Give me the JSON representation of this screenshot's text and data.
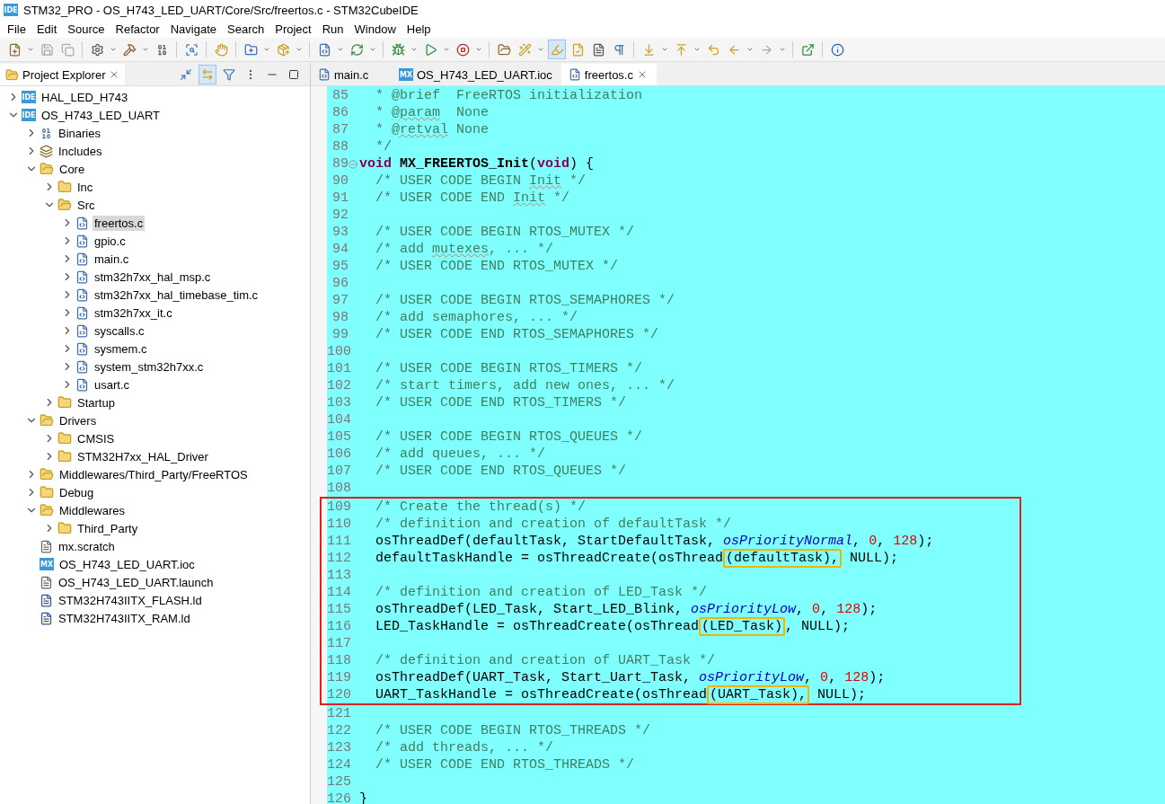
{
  "window": {
    "icon_text": "IDE",
    "title": "STM32_PRO - OS_H743_LED_UART/Core/Src/freertos.c - STM32CubeIDE"
  },
  "menu": [
    "File",
    "Edit",
    "Source",
    "Refactor",
    "Navigate",
    "Search",
    "Project",
    "Run",
    "Window",
    "Help"
  ],
  "toolbar": {
    "highlight_toggle_on": true
  },
  "explorer": {
    "title": "Project Explorer",
    "link_with_editor": true,
    "tree": [
      {
        "label": "HAL_LED_H743",
        "kind": "project",
        "badge": "IDE",
        "expanded": false,
        "selected": false
      },
      {
        "label": "OS_H743_LED_UART",
        "kind": "project",
        "badge": "IDE",
        "expanded": true,
        "selected": false,
        "children": [
          {
            "label": "Binaries",
            "kind": "binaries",
            "expanded": false,
            "selected": false
          },
          {
            "label": "Includes",
            "kind": "includes",
            "expanded": false,
            "selected": false
          },
          {
            "label": "Core",
            "kind": "source-folder",
            "expanded": true,
            "selected": false,
            "children": [
              {
                "label": "Inc",
                "kind": "folder",
                "expanded": false,
                "selected": false
              },
              {
                "label": "Src",
                "kind": "folder",
                "expanded": true,
                "selected": false,
                "children": [
                  {
                    "label": "freertos.c",
                    "kind": "c-file",
                    "expanded": false,
                    "selected": true
                  },
                  {
                    "label": "gpio.c",
                    "kind": "c-file",
                    "expanded": false,
                    "selected": false
                  },
                  {
                    "label": "main.c",
                    "kind": "c-file",
                    "expanded": false,
                    "selected": false
                  },
                  {
                    "label": "stm32h7xx_hal_msp.c",
                    "kind": "c-file",
                    "expanded": false,
                    "selected": false
                  },
                  {
                    "label": "stm32h7xx_hal_timebase_tim.c",
                    "kind": "c-file",
                    "expanded": false,
                    "selected": false
                  },
                  {
                    "label": "stm32h7xx_it.c",
                    "kind": "c-file",
                    "expanded": false,
                    "selected": false
                  },
                  {
                    "label": "syscalls.c",
                    "kind": "c-file",
                    "expanded": false,
                    "selected": false
                  },
                  {
                    "label": "sysmem.c",
                    "kind": "c-file",
                    "expanded": false,
                    "selected": false
                  },
                  {
                    "label": "system_stm32h7xx.c",
                    "kind": "c-file",
                    "expanded": false,
                    "selected": false
                  },
                  {
                    "label": "usart.c",
                    "kind": "c-file",
                    "expanded": false,
                    "selected": false
                  }
                ]
              },
              {
                "label": "Startup",
                "kind": "folder",
                "expanded": false,
                "selected": false
              }
            ]
          },
          {
            "label": "Drivers",
            "kind": "source-folder",
            "expanded": true,
            "selected": false,
            "children": [
              {
                "label": "CMSIS",
                "kind": "folder",
                "expanded": false,
                "selected": false
              },
              {
                "label": "STM32H7xx_HAL_Driver",
                "kind": "folder",
                "expanded": false,
                "selected": false
              }
            ]
          },
          {
            "label": "Middlewares/Third_Party/FreeRTOS",
            "kind": "source-folder",
            "expanded": false,
            "selected": false
          },
          {
            "label": "Debug",
            "kind": "folder",
            "expanded": false,
            "selected": false
          },
          {
            "label": "Middlewares",
            "kind": "folder",
            "expanded": true,
            "selected": false,
            "children": [
              {
                "label": "Third_Party",
                "kind": "folder",
                "expanded": false,
                "selected": false
              }
            ]
          },
          {
            "label": "mx.scratch",
            "kind": "text-file",
            "selected": false
          },
          {
            "label": "OS_H743_LED_UART.ioc",
            "kind": "mx-file",
            "badge": "MX",
            "selected": false
          },
          {
            "label": "OS_H743_LED_UART.launch",
            "kind": "text-file",
            "selected": false
          },
          {
            "label": "STM32H743IITX_FLASH.ld",
            "kind": "ld-file",
            "selected": false
          },
          {
            "label": "STM32H743IITX_RAM.ld",
            "kind": "ld-file",
            "selected": false
          }
        ]
      }
    ]
  },
  "editor": {
    "tabs": [
      {
        "label": "main.c",
        "kind": "c-file",
        "selected": false
      },
      {
        "label": "OS_H743_LED_UART.ioc",
        "kind": "mx-file",
        "badge": "MX",
        "selected": false
      },
      {
        "label": "freertos.c",
        "kind": "c-file",
        "selected": true
      }
    ],
    "blocks": [
      {
        "highlighted": false,
        "lines": [
          {
            "number": "85",
            "tokens": [
              {
                "kind": "comment",
                "text": "  * @brief  FreeRTOS initialization"
              }
            ]
          },
          {
            "number": "86",
            "tokens": [
              {
                "kind": "comment",
                "text": "  * "
              },
              {
                "kind": "comment",
                "text": "@param",
                "misspelled": true
              },
              {
                "kind": "comment",
                "text": "  None"
              }
            ]
          },
          {
            "number": "87",
            "tokens": [
              {
                "kind": "comment",
                "text": "  * "
              },
              {
                "kind": "comment",
                "text": "@retval",
                "misspelled": true
              },
              {
                "kind": "comment",
                "text": " None"
              }
            ]
          },
          {
            "number": "88",
            "tokens": [
              {
                "kind": "comment",
                "text": "  */"
              }
            ]
          },
          {
            "number": "89",
            "fold": true,
            "tokens": [
              {
                "kind": "keyword",
                "text": "void"
              },
              {
                "kind": "function",
                "text": " MX_FREERTOS_Init"
              },
              {
                "kind": "plain",
                "text": "("
              },
              {
                "kind": "keyword",
                "text": "void"
              },
              {
                "kind": "plain",
                "text": ") {"
              }
            ]
          },
          {
            "number": "90",
            "tokens": [
              {
                "kind": "comment",
                "text": "  /* USER CODE BEGIN "
              },
              {
                "kind": "comment",
                "text": "Init",
                "misspelled": true
              },
              {
                "kind": "comment",
                "text": " */"
              }
            ]
          },
          {
            "number": "91",
            "tokens": [
              {
                "kind": "comment",
                "text": "  /* USER CODE END "
              },
              {
                "kind": "comment",
                "text": "Init",
                "misspelled": true
              },
              {
                "kind": "comment",
                "text": " */"
              }
            ]
          },
          {
            "number": "92"
          },
          {
            "number": "93",
            "tokens": [
              {
                "kind": "comment",
                "text": "  /* USER CODE BEGIN RTOS_MUTEX */"
              }
            ]
          },
          {
            "number": "94",
            "tokens": [
              {
                "kind": "comment",
                "text": "  /* add "
              },
              {
                "kind": "comment",
                "text": "mutexes",
                "misspelled": true
              },
              {
                "kind": "comment",
                "text": ", ... */"
              }
            ]
          },
          {
            "number": "95",
            "tokens": [
              {
                "kind": "comment",
                "text": "  /* USER CODE END RTOS_MUTEX */"
              }
            ]
          },
          {
            "number": "96"
          },
          {
            "number": "97",
            "tokens": [
              {
                "kind": "comment",
                "text": "  /* USER CODE BEGIN RTOS_SEMAPHORES */"
              }
            ]
          },
          {
            "number": "98",
            "tokens": [
              {
                "kind": "comment",
                "text": "  /* add semaphores, ... */"
              }
            ]
          },
          {
            "number": "99",
            "tokens": [
              {
                "kind": "comment",
                "text": "  /* USER CODE END RTOS_SEMAPHORES */"
              }
            ]
          },
          {
            "number": "100"
          },
          {
            "number": "101",
            "tokens": [
              {
                "kind": "comment",
                "text": "  /* USER CODE BEGIN RTOS_TIMERS */"
              }
            ]
          },
          {
            "number": "102",
            "tokens": [
              {
                "kind": "comment",
                "text": "  /* start timers, add new ones, ... */"
              }
            ]
          },
          {
            "number": "103",
            "tokens": [
              {
                "kind": "comment",
                "text": "  /* USER CODE END RTOS_TIMERS */"
              }
            ]
          },
          {
            "number": "104"
          },
          {
            "number": "105",
            "tokens": [
              {
                "kind": "comment",
                "text": "  /* USER CODE BEGIN RTOS_QUEUES */"
              }
            ]
          },
          {
            "number": "106",
            "tokens": [
              {
                "kind": "comment",
                "text": "  /* add queues, ... */"
              }
            ]
          },
          {
            "number": "107",
            "tokens": [
              {
                "kind": "comment",
                "text": "  /* USER CODE END RTOS_QUEUES */"
              }
            ]
          },
          {
            "number": "108"
          }
        ]
      },
      {
        "highlighted": true,
        "lines": [
          {
            "number": "109",
            "tokens": [
              {
                "kind": "comment",
                "text": "  /* Create the thread(s) */"
              }
            ]
          },
          {
            "number": "110",
            "tokens": [
              {
                "kind": "comment",
                "text": "  /* definition and creation of defaultTask */"
              }
            ]
          },
          {
            "number": "111",
            "tokens": [
              {
                "kind": "plain",
                "text": "  osThreadDef(defaultTask, StartDefaultTask, "
              },
              {
                "kind": "constant",
                "text": "osPriorityNormal"
              },
              {
                "kind": "plain",
                "text": ", "
              },
              {
                "kind": "number",
                "text": "0"
              },
              {
                "kind": "plain",
                "text": ", "
              },
              {
                "kind": "number",
                "text": "128"
              },
              {
                "kind": "plain",
                "text": ");"
              }
            ]
          },
          {
            "number": "112",
            "tokens": [
              {
                "kind": "plain",
                "text": "  defaultTaskHandle = osThreadCreate(osThread"
              },
              {
                "kind": "plain",
                "text": "(defaultTask),",
                "boxed": true
              },
              {
                "kind": "plain",
                "text": " NULL);"
              }
            ]
          },
          {
            "number": "113"
          },
          {
            "number": "114",
            "tokens": [
              {
                "kind": "comment",
                "text": "  /* definition and creation of LED_Task */"
              }
            ]
          },
          {
            "number": "115",
            "tokens": [
              {
                "kind": "plain",
                "text": "  osThreadDef(LED_Task, Start_LED_Blink, "
              },
              {
                "kind": "constant",
                "text": "osPriorityLow"
              },
              {
                "kind": "plain",
                "text": ", "
              },
              {
                "kind": "number",
                "text": "0"
              },
              {
                "kind": "plain",
                "text": ", "
              },
              {
                "kind": "number",
                "text": "128"
              },
              {
                "kind": "plain",
                "text": ");"
              }
            ]
          },
          {
            "number": "116",
            "tokens": [
              {
                "kind": "plain",
                "text": "  LED_TaskHandle = osThreadCreate(osThread"
              },
              {
                "kind": "plain",
                "text": "(LED_Task)",
                "boxed": true
              },
              {
                "kind": "plain",
                "text": ", NULL);"
              }
            ]
          },
          {
            "number": "117"
          },
          {
            "number": "118",
            "tokens": [
              {
                "kind": "comment",
                "text": "  /* definition and creation of UART_Task */"
              }
            ]
          },
          {
            "number": "119",
            "tokens": [
              {
                "kind": "plain",
                "text": "  osThreadDef(UART_Task, Start_Uart_Task, "
              },
              {
                "kind": "constant",
                "text": "osPriorityLow"
              },
              {
                "kind": "plain",
                "text": ", "
              },
              {
                "kind": "number",
                "text": "0"
              },
              {
                "kind": "plain",
                "text": ", "
              },
              {
                "kind": "number",
                "text": "128"
              },
              {
                "kind": "plain",
                "text": ");"
              }
            ]
          },
          {
            "number": "120",
            "tokens": [
              {
                "kind": "plain",
                "text": "  UART_TaskHandle = osThreadCreate(osThread"
              },
              {
                "kind": "plain",
                "text": "(UART_Task),",
                "boxed": true
              },
              {
                "kind": "plain",
                "text": " NULL);"
              }
            ]
          }
        ]
      },
      {
        "highlighted": false,
        "lines": [
          {
            "number": "121"
          },
          {
            "number": "122",
            "tokens": [
              {
                "kind": "comment",
                "text": "  /* USER CODE BEGIN RTOS_THREADS */"
              }
            ]
          },
          {
            "number": "123",
            "tokens": [
              {
                "kind": "comment",
                "text": "  /* add threads, ... */"
              }
            ]
          },
          {
            "number": "124",
            "tokens": [
              {
                "kind": "comment",
                "text": "  /* USER CODE END RTOS_THREADS */"
              }
            ]
          },
          {
            "number": "125"
          },
          {
            "number": "126",
            "tokens": [
              {
                "kind": "plain",
                "text": "}"
              }
            ]
          }
        ]
      }
    ]
  }
}
